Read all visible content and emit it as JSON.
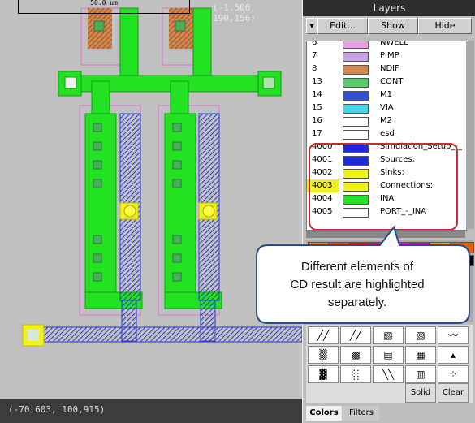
{
  "canvas": {
    "scale_label": "50.0 um",
    "coord_top": "(-1.506, 190,156)",
    "coord_bottom": "(-70,603, 100,915)"
  },
  "layers_panel": {
    "title": "Layers",
    "buttons": [
      "Edit...",
      "Show",
      "Hide"
    ],
    "layers": [
      {
        "num": "6",
        "name": "NWELL",
        "swatch": "#e6a0e6"
      },
      {
        "num": "7",
        "name": "PIMP",
        "swatch": "#c8a0e8"
      },
      {
        "num": "8",
        "name": "NDIF",
        "swatch": "#d08850"
      },
      {
        "num": "13",
        "name": "CONT",
        "swatch": "#58c868"
      },
      {
        "num": "14",
        "name": "M1",
        "swatch": "#3050d8"
      },
      {
        "num": "15",
        "name": "VIA",
        "swatch": "#40d8e8"
      },
      {
        "num": "16",
        "name": "M2",
        "swatch": "#ffffff"
      },
      {
        "num": "17",
        "name": "esd",
        "swatch": "#ffffff"
      },
      {
        "num": "4000",
        "name": "Simulation_Setup_-_",
        "swatch": "#1a2ad8"
      },
      {
        "num": "4001",
        "name": "Sources:",
        "swatch": "#1a2ad8"
      },
      {
        "num": "4002",
        "name": "Sinks:",
        "swatch": "#f0f020"
      },
      {
        "num": "4003",
        "name": "Connections:",
        "swatch": "#f0f020",
        "selected": true
      },
      {
        "num": "4004",
        "name": "INA",
        "swatch": "#22e022"
      },
      {
        "num": "4005",
        "name": "PORT_-_INA",
        "swatch": "#ffffff"
      }
    ],
    "palette_colors": [
      "#ff8000",
      "#ff4000",
      "#ff0000",
      "#e00060",
      "#ff00ff",
      "#c000c0",
      "#ffa000",
      "#e06000",
      "#00c000",
      "#008000",
      "#00e080",
      "#00a0a0",
      "#00ffff",
      "#0080ff",
      "#8000ff",
      "#000000"
    ],
    "pattern_buttons": [
      "Solid",
      "Clear"
    ],
    "tabs": [
      "Colors",
      "Filters"
    ]
  },
  "callout": {
    "lines": [
      "Different elements of",
      "CD result are highlighted",
      "separately."
    ]
  }
}
